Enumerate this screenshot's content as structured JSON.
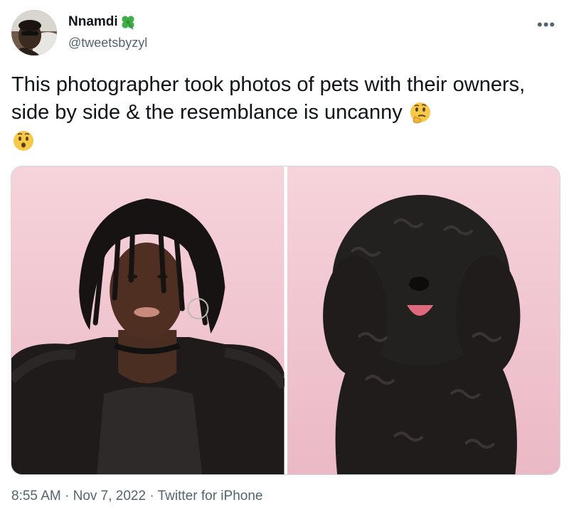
{
  "tweet": {
    "author": {
      "display_name": "Nnamdi",
      "badge_emoji": "four-leaf-clover",
      "handle": "@tweetsbyzyl"
    },
    "more_icon": "more-dots-icon",
    "text": "This photographer took photos of pets with their owners, side by side & the resemblance is uncanny",
    "emojis": [
      "thinking-face",
      "hushed-face"
    ],
    "media": [
      {
        "name": "owner-photo",
        "description_icon": "person-portrait"
      },
      {
        "name": "dog-photo",
        "description_icon": "dog-portrait"
      }
    ],
    "meta": {
      "time": "8:55 AM",
      "sep1": "·",
      "date": "Nov 7, 2022",
      "sep2": "·",
      "source": "Twitter for iPhone"
    },
    "colors": {
      "pink_backdrop": "#f3c9d3",
      "secondary_text": "#536471",
      "primary_text": "#0f1419",
      "clover_green": "#3fae49"
    }
  }
}
